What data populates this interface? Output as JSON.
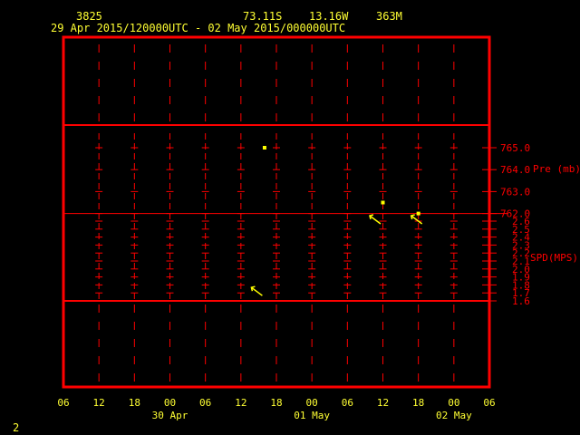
{
  "header": {
    "station_id": "3825",
    "latitude": "73.11S",
    "longitude": "13.16W",
    "elevation": "363M",
    "time_range": "29 Apr 2015/120000UTC - 02 May 2015/000000UTC"
  },
  "footer": {
    "page_number": "2"
  },
  "colors": {
    "frame": "#ff0000",
    "text": "#ffff33",
    "data": "#ffff00"
  },
  "chart_data": {
    "type": "scatter",
    "x_hours_start": "29 Apr 2015 06UTC",
    "x_tick_labels": [
      "06",
      "12",
      "18",
      "00",
      "06",
      "12",
      "18",
      "00",
      "06",
      "12",
      "18",
      "00",
      "06"
    ],
    "x_date_labels": [
      {
        "label": "30 Apr",
        "tick_index": 3
      },
      {
        "label": "01 May",
        "tick_index": 7
      },
      {
        "label": "02 May",
        "tick_index": 11
      }
    ],
    "pressure": {
      "label": "Pre (mb)",
      "tick_labels": [
        "765.0",
        "764.0",
        "763.0",
        "762.0"
      ],
      "ylim": [
        762.0,
        765.0
      ],
      "points": [
        {
          "hour": 34,
          "value": 765.0
        },
        {
          "hour": 54,
          "value": 762.5
        },
        {
          "hour": 60,
          "value": 762.0
        }
      ]
    },
    "speed": {
      "label": "SPD(MPS)",
      "tick_labels": [
        "2.6",
        "2.5",
        "2.4",
        "2.3",
        "2.2",
        "2.1",
        "2.0",
        "1.9",
        "1.8",
        "1.7",
        "1.6"
      ],
      "ylim": [
        1.6,
        2.6
      ],
      "points": [
        {
          "hour": 33,
          "value": 1.7,
          "direction_deg": 135
        },
        {
          "hour": 53,
          "value": 2.6,
          "direction_deg": 120
        },
        {
          "hour": 60,
          "value": 2.6,
          "direction_deg": 145
        }
      ]
    }
  }
}
